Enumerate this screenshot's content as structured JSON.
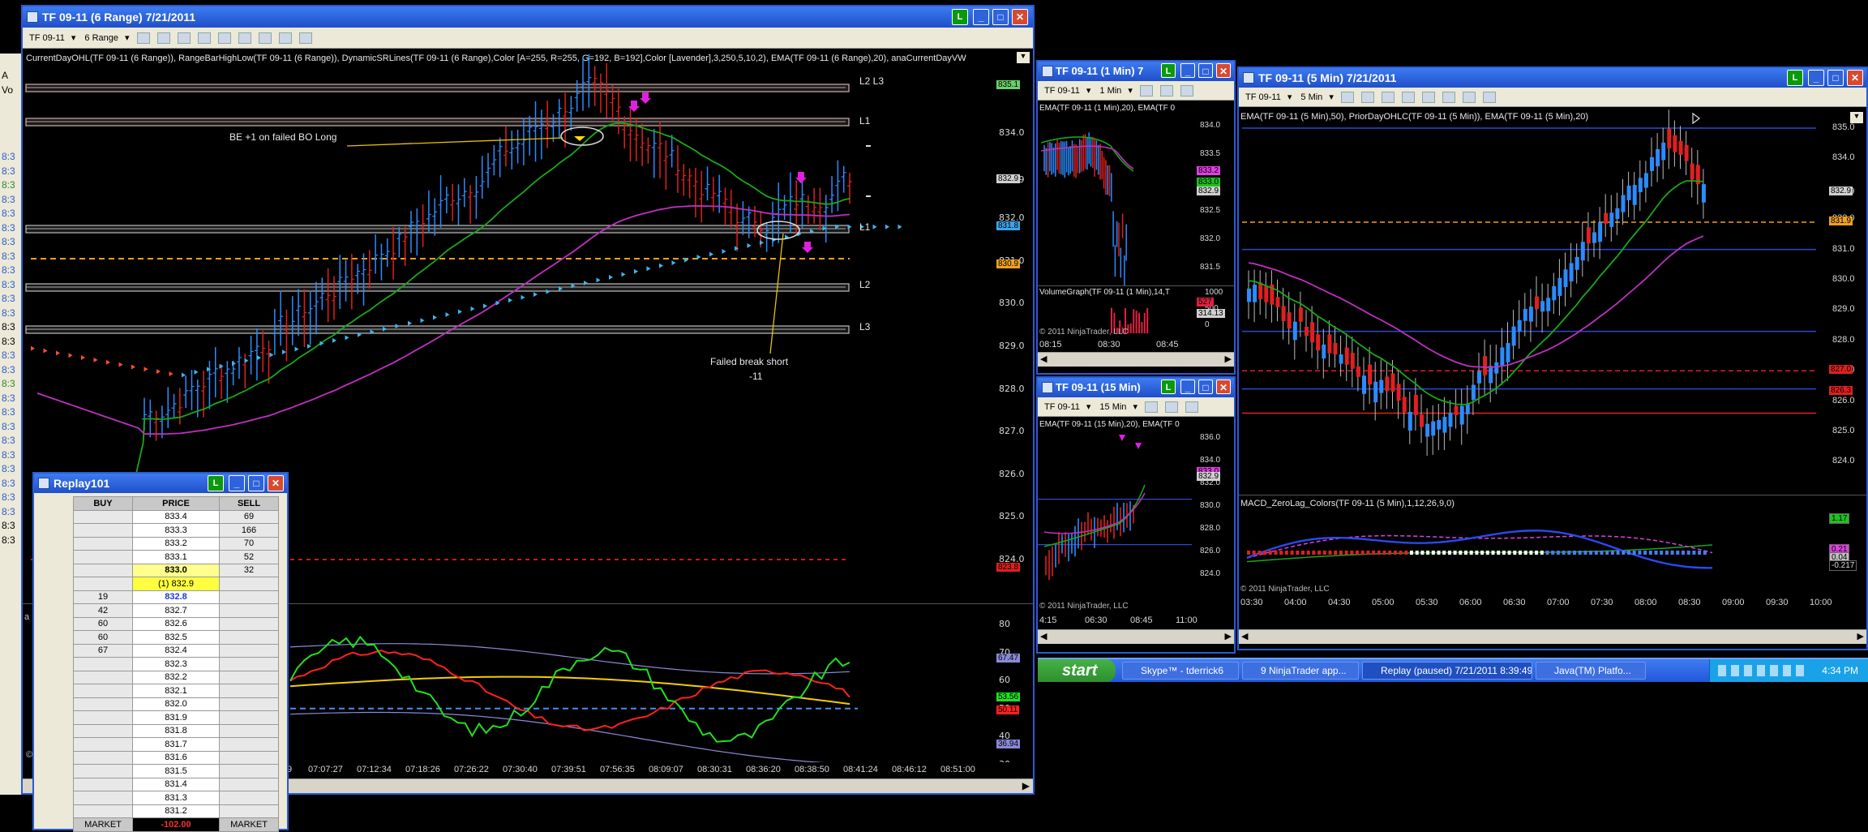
{
  "main_window": {
    "title": "TF 09-11 (6 Range)  7/21/2011",
    "instrument": "TF 09-11",
    "period": "6 Range",
    "indicators_text": "CurrentDayOHL(TF 09-11 (6 Range)), RangeBarHighLow(TF 09-11 (6 Range)), DynamicSRLines(TF 09-11 (6 Range),Color [A=255, R=255, G=192, B=192],Color [Lavender],3,250,5,10,2), EMA(TF 09-11 (6 Range),20), anaCurrentDayVW",
    "level_labels": [
      "L2 L3",
      "L1",
      "L1",
      "L2",
      "L3"
    ],
    "annotation_be": "BE +1 on failed BO Long",
    "annotation_fail_1": "Failed break short",
    "annotation_fail_2": "-11",
    "price_axis": [
      "834.0",
      "832.9",
      "832.0",
      "831.0",
      "830.0",
      "829.0",
      "828.0",
      "827.0",
      "826.0",
      "825.0",
      "824.0"
    ],
    "price_tags": [
      "835.1",
      "832.9",
      "831.8",
      "830.9",
      "823.8"
    ],
    "osc_axis": [
      "80",
      "70",
      "60",
      "50",
      "40",
      "30"
    ],
    "osc_tags": [
      "67.47",
      "53.56",
      "50.11",
      "36.94"
    ],
    "time_axis": [
      "07:07:27",
      "07:12:34",
      "07:18:26",
      "07:26:22",
      "07:30:40",
      "07:39:51",
      "07:56:35",
      "08:09:07",
      "08:30:31",
      "08:36:20",
      "08:38:50",
      "08:41:24",
      "08:46:12",
      "08:51:00"
    ],
    "time_axis_partial": "9",
    "copyright_partial": "©",
    "left_edge_partial": "a",
    "behind_labels": [
      "A",
      "Vo",
      "8:3",
      "8:3",
      "8:3",
      "8:3",
      "8:3",
      "8:3",
      "8:3",
      "8:3",
      "8:3",
      "8:3",
      "8:3",
      "8:3",
      "8:3",
      "8:3",
      "8:3",
      "8:3",
      "8:3",
      "8:3",
      "8:3",
      "8:3",
      "8:3",
      "8:3",
      "8:3",
      "8:3",
      "8:3",
      "8:3",
      "8:3",
      "8:3"
    ]
  },
  "replay_window": {
    "title": "Replay101",
    "headers": [
      "BUY",
      "PRICE",
      "SELL"
    ],
    "rows": [
      {
        "buy": "",
        "price": "833.4",
        "sell": "69"
      },
      {
        "buy": "",
        "price": "833.3",
        "sell": "166"
      },
      {
        "buy": "",
        "price": "833.2",
        "sell": "70"
      },
      {
        "buy": "",
        "price": "833.1",
        "sell": "52"
      },
      {
        "buy": "",
        "price": "833.0",
        "sell": "32"
      },
      {
        "buy": "",
        "price": "(1) 832.9",
        "sell": ""
      },
      {
        "buy": "19",
        "price": "832.8",
        "sell": ""
      },
      {
        "buy": "42",
        "price": "832.7",
        "sell": ""
      },
      {
        "buy": "60",
        "price": "832.6",
        "sell": ""
      },
      {
        "buy": "60",
        "price": "832.5",
        "sell": ""
      },
      {
        "buy": "67",
        "price": "832.4",
        "sell": ""
      },
      {
        "buy": "",
        "price": "832.3",
        "sell": ""
      },
      {
        "buy": "",
        "price": "832.2",
        "sell": ""
      },
      {
        "buy": "",
        "price": "832.1",
        "sell": ""
      },
      {
        "buy": "",
        "price": "832.0",
        "sell": ""
      },
      {
        "buy": "",
        "price": "831.9",
        "sell": ""
      },
      {
        "buy": "",
        "price": "831.8",
        "sell": ""
      },
      {
        "buy": "",
        "price": "831.7",
        "sell": ""
      },
      {
        "buy": "",
        "price": "831.6",
        "sell": ""
      },
      {
        "buy": "",
        "price": "831.5",
        "sell": ""
      },
      {
        "buy": "",
        "price": "831.4",
        "sell": ""
      },
      {
        "buy": "",
        "price": "831.3",
        "sell": ""
      },
      {
        "buy": "",
        "price": "831.2",
        "sell": ""
      }
    ],
    "footer": {
      "buy": "MARKET",
      "price": "-102.00",
      "sell": "MARKET"
    }
  },
  "win_1min": {
    "title": "TF 09-11 (1 Min)  7",
    "instrument": "TF 09-11",
    "period": "1 Min",
    "indicators_text": "EMA(TF 09-11 (1 Min),20), EMA(TF 0",
    "price_axis": [
      "834.0",
      "833.5",
      "833.0",
      "832.5",
      "832.0",
      "831.5"
    ],
    "price_tags": [
      "833.2",
      "833.0",
      "832.9"
    ],
    "volume_text": "VolumeGraph(TF 09-11 (1 Min),14,T",
    "volume_axis": [
      "1000",
      "500",
      "0"
    ],
    "volume_tags": [
      "527",
      "314.13"
    ],
    "copyright": "© 2011 NinjaTrader, LLC",
    "time_axis": [
      "08:15",
      "08:30",
      "08:45"
    ]
  },
  "win_15min": {
    "title": "TF 09-11 (15 Min)",
    "instrument": "TF 09-11",
    "period": "15 Min",
    "indicators_text": "EMA(TF 09-11 (15 Min),20), EMA(TF 0",
    "price_axis": [
      "836.0",
      "834.0",
      "832.0",
      "830.0",
      "828.0",
      "826.0",
      "824.0"
    ],
    "price_tags": [
      "833.0",
      "832.9"
    ],
    "copyright": "© 2011 NinjaTrader, LLC",
    "time_axis": [
      "4:15",
      "06:30",
      "08:45",
      "11:00"
    ]
  },
  "win_5min": {
    "title": "TF 09-11 (5 Min)  7/21/2011",
    "instrument": "TF 09-11",
    "period": "5 Min",
    "indicators_text": "EMA(TF 09-11 (5 Min),50), PriorDayOHLC(TF 09-11 (5 Min)), EMA(TF 09-11 (5 Min),20)",
    "price_axis": [
      "835.0",
      "834.0",
      "832.9",
      "832.0",
      "831.0",
      "830.0",
      "829.0",
      "828.0",
      "827.0",
      "826.0",
      "825.0",
      "824.0"
    ],
    "price_tags": [
      "832.9",
      "831.9",
      "827.0",
      "826.3"
    ],
    "macd_text": "MACD_ZeroLag_Colors(TF 09-11 (5 Min),1,12,26,9,0)",
    "macd_tags": [
      "1.17",
      "0.21",
      "0.04",
      "-0.217"
    ],
    "copyright": "© 2011 NinjaTrader, LLC",
    "time_axis": [
      "03:30",
      "04:00",
      "04:30",
      "05:00",
      "05:30",
      "06:00",
      "06:30",
      "07:00",
      "07:30",
      "08:00",
      "08:30",
      "09:00",
      "09:30",
      "10:00"
    ]
  },
  "taskbar": {
    "start": "start",
    "tasks": [
      "Skype™ - tderrick6",
      "9 NinjaTrader app...",
      "Replay (paused) 7/21/2011 8:39:49 AM",
      "Java(TM) Platfo..."
    ],
    "clock": "4:34 PM"
  }
}
